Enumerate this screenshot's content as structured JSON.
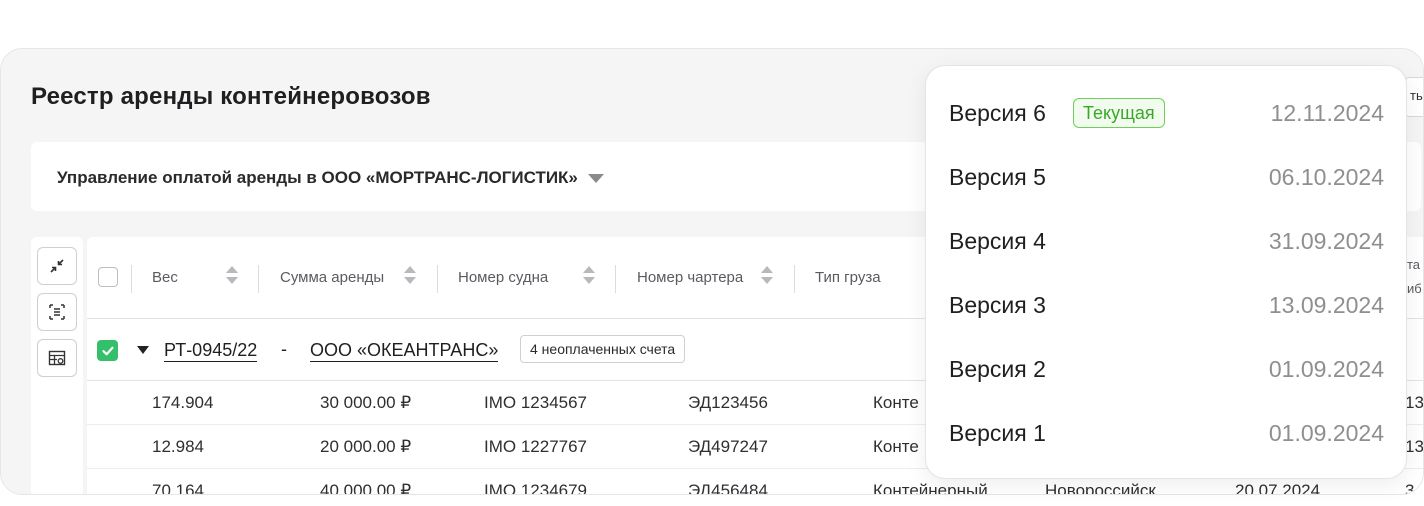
{
  "page": {
    "title": "Реестр аренды контейнеровозов",
    "peek_text": "ть"
  },
  "company_select": {
    "value": "Управление оплатой аренды в ООО «МОРТРАНС-ЛОГИСТИК»"
  },
  "tools": [
    {
      "name": "collapse-icon"
    },
    {
      "name": "fit-rows-icon"
    },
    {
      "name": "table-settings-icon"
    }
  ],
  "table": {
    "headers": [
      "Вес",
      "Сумма аренды",
      "Номер судна",
      "Номер чартера",
      "Тип груза"
    ],
    "right_edge_header": [
      "та",
      "иб"
    ],
    "group": {
      "code": "РТ-0945/22",
      "separator": "-",
      "company": "ООО «ОКЕАНТРАНС»",
      "badge": "4 неоплаченных счета"
    },
    "rows": [
      {
        "weight": "174.904",
        "amount": "30 000.00 ₽",
        "vessel": "IMO 1234567",
        "charter": "ЭД123456",
        "cargo": "Конте",
        "port": "",
        "date": "",
        "edge": "13"
      },
      {
        "weight": "12.984",
        "amount": "20 000.00 ₽",
        "vessel": "IMO 1227767",
        "charter": "ЭД497247",
        "cargo": "Конте",
        "port": "",
        "date": "",
        "edge": "13"
      },
      {
        "weight": "70.164",
        "amount": "40 000.00 ₽",
        "vessel": "IMO 1234679",
        "charter": "ЭД456484",
        "cargo": "Контейнерный",
        "port": "Новороссийск",
        "date": "20.07.2024",
        "edge": "3"
      }
    ]
  },
  "versions": {
    "current_badge": "Текущая",
    "items": [
      {
        "label": "Версия 6",
        "date": "12.11.2024",
        "current": true
      },
      {
        "label": "Версия 5",
        "date": "06.10.2024"
      },
      {
        "label": "Версия 4",
        "date": "31.09.2024"
      },
      {
        "label": "Версия 3",
        "date": "13.09.2024"
      },
      {
        "label": "Версия 2",
        "date": "01.09.2024"
      },
      {
        "label": "Версия 1",
        "date": "01.09.2024"
      }
    ]
  },
  "colors": {
    "accent_green": "#34c06b",
    "badge_green": "#3ba82a",
    "muted_text": "#8e8e93"
  }
}
